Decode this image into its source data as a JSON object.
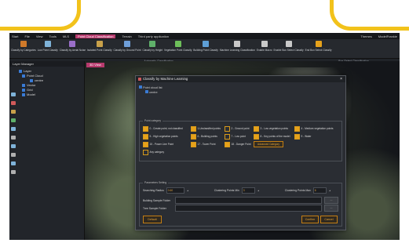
{
  "menubar": {
    "items": [
      "Start",
      "File",
      "View",
      "Tools",
      "MLS"
    ],
    "active": "Point Cloud Classification",
    "more": [
      "Terrain",
      "Third party application"
    ],
    "right": [
      "Themes",
      "ModelFrankie"
    ]
  },
  "ribbon": {
    "buttons": [
      {
        "label": "Classify by Categories",
        "icon_color": "#d07a2a"
      },
      {
        "label": "Low Point Classify",
        "icon_color": "#7fb3d9"
      },
      {
        "label": "Classify by Aerial Noise",
        "icon_color": "#9a6fc9"
      },
      {
        "label": "Isolated Point Classify",
        "icon_color": "#c9a14a"
      },
      {
        "label": "Classify by Ground Point",
        "icon_color": "#6f9fd9"
      },
      {
        "label": "Classify by Height",
        "icon_color": "#5fb06a"
      },
      {
        "label": "Vegetation Point Classify",
        "icon_color": "#6dbf5a"
      },
      {
        "label": "Building Point Classify",
        "icon_color": "#5e9fd6"
      },
      {
        "label": "Machine Learning Classification",
        "icon_color": "#c9c9c9"
      },
      {
        "label": "Enable Macro",
        "icon_color": "#c9c9c9"
      },
      {
        "label": "Enable Box Select Classify",
        "icon_color": "#c9c9c9"
      },
      {
        "label": "End Box Select Classify",
        "icon_color": "#e6a21b"
      }
    ],
    "groups": [
      "Automatic Classification",
      "Box-Select Classification"
    ]
  },
  "layer_manager": {
    "title": "Layer Manager",
    "root": "Layer",
    "items": [
      "Point Cloud",
      "centre",
      "Vector",
      "Grid",
      "Model"
    ]
  },
  "viewport": {
    "tab": "3D View"
  },
  "dialog": {
    "title": "Classify by Machine Learning",
    "tree": [
      "Point cloud list",
      "centre"
    ],
    "category_legend": "Point category",
    "categories": [
      {
        "label": "0 - Create point, not classified",
        "checked": true
      },
      {
        "label": "1-Unclassified points",
        "checked": true
      },
      {
        "label": "2 - Ground point",
        "checked": false
      },
      {
        "label": "3 - Low vegetation points",
        "checked": true
      },
      {
        "label": "4 - Medium vegetation points",
        "checked": true
      },
      {
        "label": "5 - High vegetation points",
        "checked": true
      },
      {
        "label": "6 - Building points",
        "checked": true
      },
      {
        "label": "7 - Low point",
        "checked": false
      },
      {
        "label": "8 - Key points of the model",
        "checked": true
      },
      {
        "label": "9 - Water",
        "checked": true
      },
      {
        "label": "15 - Power Line Point",
        "checked": true
      },
      {
        "label": "17 - Tower Point",
        "checked": true
      },
      {
        "label": "18 - Danger Point",
        "checked": true
      },
      {
        "label": "Any category",
        "checked": false
      }
    ],
    "advanced_button": "Advanced Category",
    "param_legend": "Parameters Setting",
    "searching_radius_label": "Searching Radius",
    "searching_radius": "0.60",
    "clustering_min_label": "Clustering Points Min",
    "clustering_min": "3",
    "clustering_max_label": "Clustering Points Max",
    "clustering_max": "6",
    "building_folder_label": "Building Sample Folder",
    "tree_folder_label": "Tree Sample Folder",
    "browse_label": "...",
    "default_button": "Default",
    "confirm_button": "Confirm",
    "cancel_button": "Cancel"
  }
}
